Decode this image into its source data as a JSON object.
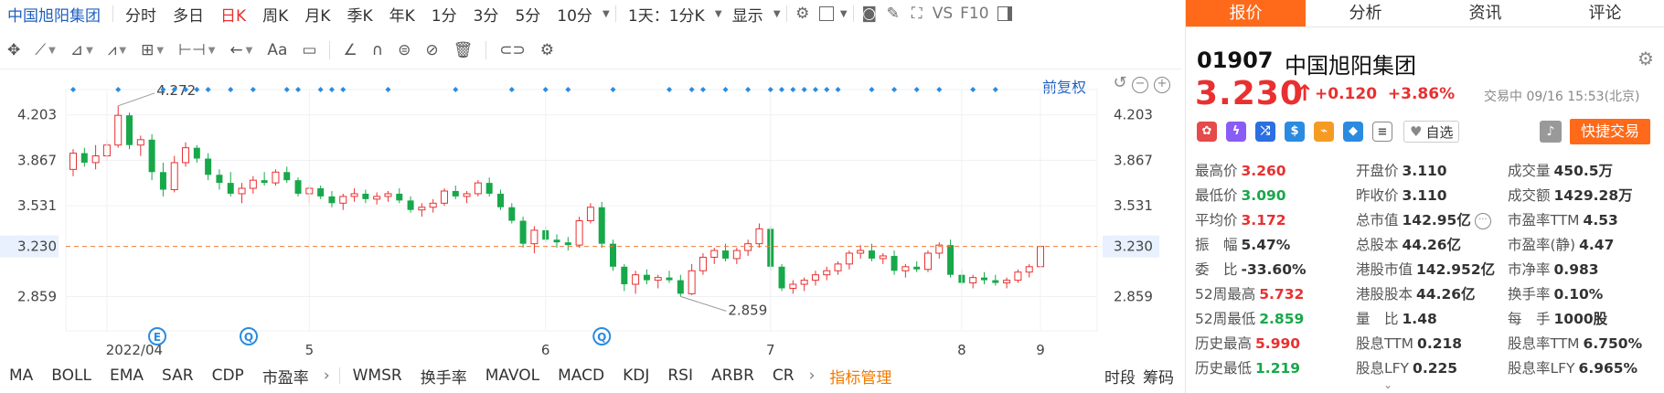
{
  "toolbar": {
    "title": "中国旭阳集团",
    "periods": [
      "分时",
      "多日",
      "日K",
      "周K",
      "月K",
      "季K",
      "年K",
      "1分",
      "3分",
      "5分",
      "10分"
    ],
    "active_period": "日K",
    "range_label": "1天：1分K",
    "display_label": "显示",
    "vs_label": "VS",
    "f10_label": "F10"
  },
  "drawing_tools": {
    "text_tool": "Aa"
  },
  "chart_controls": {
    "fuquan_label": "前复权"
  },
  "chart_data": {
    "type": "candlestick",
    "y_ticks": [
      "4.203",
      "3.867",
      "3.531",
      "3.230",
      "2.859"
    ],
    "current_price_label": "3.230",
    "x_labels": [
      "2022/04",
      "5",
      "6",
      "7",
      "8",
      "9"
    ],
    "max_annotation": "4.272",
    "min_annotation": "2.859",
    "event_markers": [
      "Q",
      "E",
      "Q"
    ],
    "ylim": [
      2.7,
      4.35
    ],
    "candles": [
      [
        3.8,
        3.95,
        3.75,
        3.92
      ],
      [
        3.92,
        3.96,
        3.82,
        3.85
      ],
      [
        3.85,
        3.98,
        3.8,
        3.9
      ],
      [
        3.9,
        4.02,
        3.86,
        3.98
      ],
      [
        3.98,
        4.27,
        3.96,
        4.2
      ],
      [
        4.2,
        4.22,
        3.95,
        3.98
      ],
      [
        3.98,
        4.05,
        3.9,
        4.02
      ],
      [
        4.02,
        4.06,
        3.72,
        3.78
      ],
      [
        3.78,
        3.85,
        3.6,
        3.65
      ],
      [
        3.65,
        3.9,
        3.63,
        3.85
      ],
      [
        3.85,
        4.0,
        3.82,
        3.96
      ],
      [
        3.96,
        3.98,
        3.85,
        3.88
      ],
      [
        3.88,
        3.92,
        3.72,
        3.76
      ],
      [
        3.76,
        3.8,
        3.65,
        3.7
      ],
      [
        3.7,
        3.78,
        3.6,
        3.62
      ],
      [
        3.62,
        3.7,
        3.55,
        3.66
      ],
      [
        3.66,
        3.75,
        3.62,
        3.72
      ],
      [
        3.72,
        3.78,
        3.68,
        3.7
      ],
      [
        3.7,
        3.8,
        3.68,
        3.78
      ],
      [
        3.78,
        3.82,
        3.7,
        3.72
      ],
      [
        3.72,
        3.74,
        3.6,
        3.62
      ],
      [
        3.62,
        3.68,
        3.55,
        3.66
      ],
      [
        3.66,
        3.68,
        3.58,
        3.6
      ],
      [
        3.6,
        3.64,
        3.52,
        3.55
      ],
      [
        3.55,
        3.62,
        3.5,
        3.6
      ],
      [
        3.6,
        3.66,
        3.56,
        3.62
      ],
      [
        3.62,
        3.65,
        3.55,
        3.58
      ],
      [
        3.58,
        3.63,
        3.54,
        3.6
      ],
      [
        3.6,
        3.64,
        3.56,
        3.62
      ],
      [
        3.62,
        3.66,
        3.55,
        3.57
      ],
      [
        3.57,
        3.6,
        3.48,
        3.5
      ],
      [
        3.5,
        3.55,
        3.45,
        3.52
      ],
      [
        3.52,
        3.58,
        3.48,
        3.55
      ],
      [
        3.55,
        3.66,
        3.53,
        3.64
      ],
      [
        3.64,
        3.68,
        3.58,
        3.6
      ],
      [
        3.6,
        3.64,
        3.55,
        3.62
      ],
      [
        3.62,
        3.72,
        3.6,
        3.7
      ],
      [
        3.7,
        3.74,
        3.6,
        3.62
      ],
      [
        3.62,
        3.65,
        3.5,
        3.52
      ],
      [
        3.52,
        3.55,
        3.4,
        3.42
      ],
      [
        3.42,
        3.45,
        3.22,
        3.25
      ],
      [
        3.25,
        3.38,
        3.18,
        3.35
      ],
      [
        3.35,
        3.38,
        3.26,
        3.28
      ],
      [
        3.28,
        3.32,
        3.22,
        3.26
      ],
      [
        3.26,
        3.3,
        3.2,
        3.24
      ],
      [
        3.24,
        3.45,
        3.22,
        3.42
      ],
      [
        3.42,
        3.55,
        3.4,
        3.52
      ],
      [
        3.52,
        3.56,
        3.22,
        3.25
      ],
      [
        3.25,
        3.28,
        3.05,
        3.08
      ],
      [
        3.08,
        3.1,
        2.9,
        2.95
      ],
      [
        2.95,
        3.05,
        2.88,
        3.02
      ],
      [
        3.02,
        3.06,
        2.95,
        2.98
      ],
      [
        2.98,
        3.02,
        2.92,
        3.0
      ],
      [
        3.0,
        3.05,
        2.96,
        2.98
      ],
      [
        2.98,
        3.02,
        2.86,
        2.88
      ],
      [
        2.88,
        3.1,
        2.87,
        3.05
      ],
      [
        3.05,
        3.18,
        3.02,
        3.15
      ],
      [
        3.15,
        3.22,
        3.1,
        3.2
      ],
      [
        3.2,
        3.25,
        3.12,
        3.14
      ],
      [
        3.14,
        3.22,
        3.1,
        3.2
      ],
      [
        3.2,
        3.28,
        3.16,
        3.25
      ],
      [
        3.25,
        3.4,
        3.22,
        3.36
      ],
      [
        3.36,
        3.38,
        3.05,
        3.08
      ],
      [
        3.08,
        3.1,
        2.9,
        2.92
      ],
      [
        2.92,
        2.98,
        2.88,
        2.95
      ],
      [
        2.95,
        3.0,
        2.9,
        2.98
      ],
      [
        2.98,
        3.05,
        2.94,
        3.02
      ],
      [
        3.02,
        3.08,
        2.98,
        3.05
      ],
      [
        3.05,
        3.12,
        3.02,
        3.1
      ],
      [
        3.1,
        3.2,
        3.06,
        3.18
      ],
      [
        3.18,
        3.24,
        3.14,
        3.2
      ],
      [
        3.2,
        3.25,
        3.12,
        3.14
      ],
      [
        3.14,
        3.18,
        3.1,
        3.16
      ],
      [
        3.16,
        3.2,
        3.02,
        3.05
      ],
      [
        3.05,
        3.1,
        3.0,
        3.08
      ],
      [
        3.08,
        3.12,
        3.04,
        3.06
      ],
      [
        3.06,
        3.2,
        3.04,
        3.18
      ],
      [
        3.18,
        3.26,
        3.14,
        3.24
      ],
      [
        3.24,
        3.28,
        3.0,
        3.02
      ],
      [
        3.02,
        3.06,
        2.94,
        2.96
      ],
      [
        2.96,
        3.02,
        2.92,
        3.0
      ],
      [
        3.0,
        3.04,
        2.95,
        2.98
      ],
      [
        2.98,
        3.02,
        2.94,
        2.96
      ],
      [
        2.96,
        3.0,
        2.92,
        2.98
      ],
      [
        2.98,
        3.06,
        2.96,
        3.04
      ],
      [
        3.04,
        3.1,
        3.0,
        3.08
      ],
      [
        3.08,
        3.26,
        3.09,
        3.23
      ]
    ]
  },
  "indicators": [
    "MA",
    "BOLL",
    "EMA",
    "SAR",
    "CDP",
    "市盈率",
    "WMSR",
    "换手率",
    "MAVOL",
    "MACD",
    "KDJ",
    "RSI",
    "ARBR",
    "CR"
  ],
  "indicator_mgmt": "指标管理",
  "bottom_right": [
    "时段",
    "筹码"
  ],
  "right_panel": {
    "tabs": [
      "报价",
      "分析",
      "资讯",
      "评论"
    ],
    "code": "01907",
    "name": "中国旭阳集团",
    "price": "3.230",
    "change": "+0.120",
    "change_pct": "+3.86%",
    "status": "交易中 09/16 15:53(北京)",
    "fav_label": "自选",
    "trade_label": "快捷交易",
    "colors": {
      "up": "#e93030",
      "down": "#17a84a",
      "accent": "#ff6a1a"
    },
    "stats": [
      [
        {
          "k": "最高价",
          "v": "3.260",
          "c": "red"
        },
        {
          "k": "开盘价",
          "v": "3.110",
          "c": ""
        },
        {
          "k": "成交量",
          "v": "450.5万",
          "c": ""
        }
      ],
      [
        {
          "k": "最低价",
          "v": "3.090",
          "c": "green"
        },
        {
          "k": "昨收价",
          "v": "3.110",
          "c": ""
        },
        {
          "k": "成交额",
          "v": "1429.28万",
          "c": ""
        }
      ],
      [
        {
          "k": "平均价",
          "v": "3.172",
          "c": "red"
        },
        {
          "k": "总市值",
          "v": "142.95亿",
          "c": ""
        },
        {
          "k": "市盈率TTM",
          "v": "4.53",
          "c": ""
        }
      ],
      [
        {
          "k": "振　幅",
          "v": "5.47%",
          "c": ""
        },
        {
          "k": "总股本",
          "v": "44.26亿",
          "c": ""
        },
        {
          "k": "市盈率(静)",
          "v": "4.47",
          "c": ""
        }
      ],
      [
        {
          "k": "委　比",
          "v": "-33.60%",
          "c": ""
        },
        {
          "k": "港股市值",
          "v": "142.952亿",
          "c": ""
        },
        {
          "k": "市净率",
          "v": "0.983",
          "c": ""
        }
      ],
      [
        {
          "k": "52周最高",
          "v": "5.732",
          "c": "red"
        },
        {
          "k": "港股股本",
          "v": "44.26亿",
          "c": ""
        },
        {
          "k": "换手率",
          "v": "0.10%",
          "c": ""
        }
      ],
      [
        {
          "k": "52周最低",
          "v": "2.859",
          "c": "green"
        },
        {
          "k": "量　比",
          "v": "1.48",
          "c": ""
        },
        {
          "k": "每　手",
          "v": "1000股",
          "c": ""
        }
      ],
      [
        {
          "k": "历史最高",
          "v": "5.990",
          "c": "red"
        },
        {
          "k": "股息TTM",
          "v": "0.218",
          "c": ""
        },
        {
          "k": "股息率TTM",
          "v": "6.750%",
          "c": ""
        }
      ],
      [
        {
          "k": "历史最低",
          "v": "1.219",
          "c": "green"
        },
        {
          "k": "股息LFY",
          "v": "0.225",
          "c": ""
        },
        {
          "k": "股息率LFY",
          "v": "6.965%",
          "c": ""
        }
      ]
    ]
  }
}
